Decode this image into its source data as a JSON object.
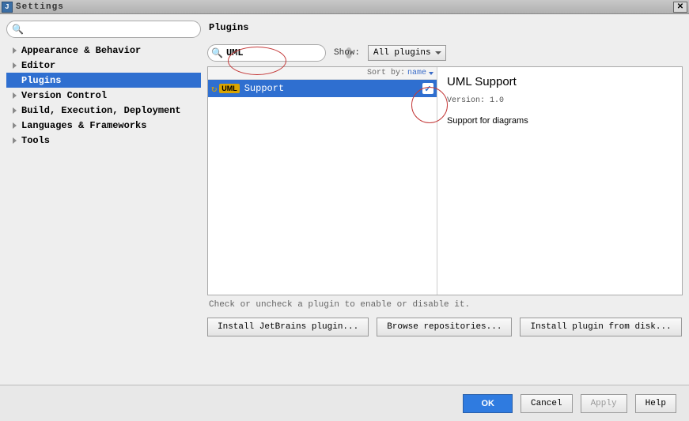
{
  "window": {
    "title": "Settings"
  },
  "sidebar": {
    "search_placeholder": "",
    "items": [
      {
        "label": "Appearance & Behavior",
        "expandable": true
      },
      {
        "label": "Editor",
        "expandable": true
      },
      {
        "label": "Plugins",
        "expandable": false,
        "selected": true
      },
      {
        "label": "Version Control",
        "expandable": true
      },
      {
        "label": "Build, Execution, Deployment",
        "expandable": true
      },
      {
        "label": "Languages & Frameworks",
        "expandable": true
      },
      {
        "label": "Tools",
        "expandable": true
      }
    ]
  },
  "plugins": {
    "page_title": "Plugins",
    "search_value": "UML",
    "show_label": "Show:",
    "show_filter": "All plugins",
    "sort_prefix": "Sort by:",
    "sort_value": "name",
    "list": [
      {
        "badge": "UML",
        "name": "Support",
        "checked": true
      }
    ],
    "detail": {
      "title": "UML Support",
      "version_label": "Version: 1.0",
      "description": "Support for diagrams"
    },
    "hint": "Check or uncheck a plugin to enable or disable it.",
    "buttons": {
      "install_jetbrains": "Install JetBrains plugin...",
      "browse_repos": "Browse repositories...",
      "install_disk": "Install plugin from disk..."
    }
  },
  "footer": {
    "ok": "OK",
    "cancel": "Cancel",
    "apply": "Apply",
    "help": "Help"
  }
}
